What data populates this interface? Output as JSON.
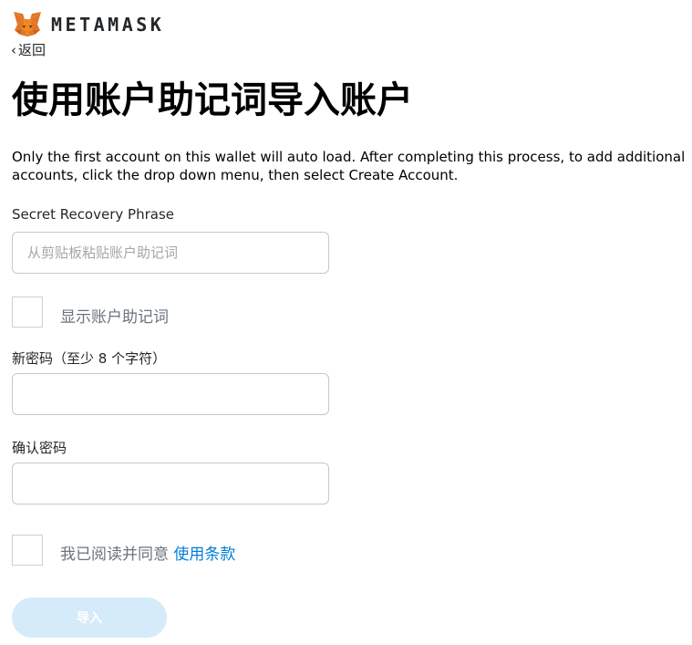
{
  "brand": {
    "wordmark": "METAMASK",
    "icon": "metamask-fox-icon"
  },
  "nav": {
    "back_label": "返回",
    "back_icon": "chevron-left-icon"
  },
  "page": {
    "title": "使用账户助记词导入账户",
    "description": "Only the first account on this wallet will auto load. After completing this process, to add additional accounts, click the drop down menu, then select Create Account."
  },
  "form": {
    "srp_label": "Secret Recovery Phrase",
    "srp_placeholder": "从剪贴板粘贴账户助记词",
    "srp_value": "",
    "show_srp_label": "显示账户助记词",
    "show_srp_checked": false,
    "new_password_label": "新密码（至少 8 个字符）",
    "new_password_value": "",
    "confirm_password_label": "确认密码",
    "confirm_password_value": "",
    "terms_prefix": "我已阅读并同意",
    "terms_link": "使用条款",
    "terms_checked": false,
    "import_button": "导入"
  },
  "colors": {
    "link": "#037dd6",
    "button_disabled_bg": "#d6ebf9",
    "muted_text": "#6a737d"
  }
}
